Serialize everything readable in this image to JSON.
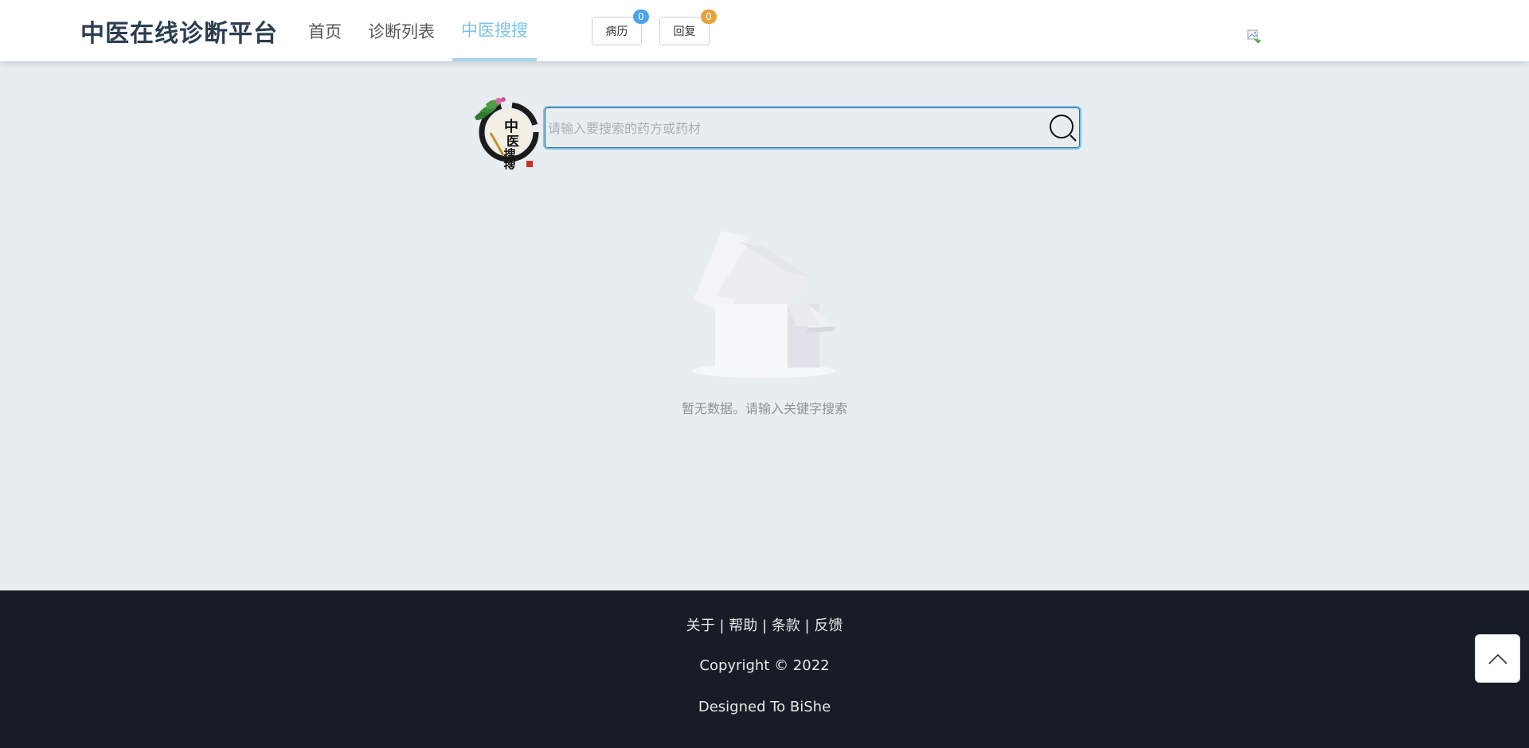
{
  "header": {
    "brand": "中医在线诊断平台",
    "nav": [
      {
        "label": "首页",
        "active": false
      },
      {
        "label": "诊断列表",
        "active": false
      },
      {
        "label": "中医搜搜",
        "active": true
      }
    ],
    "pills": [
      {
        "label": "病历",
        "badge": "0",
        "badge_color": "#4aa3ea"
      },
      {
        "label": "回复",
        "badge": "0",
        "badge_color": "#e6a23c"
      }
    ],
    "avatar_icon": "broken-image-icon"
  },
  "search": {
    "logo_text": "中医搜搜",
    "placeholder": "请输入要搜索的药方或药材",
    "value": "",
    "button_icon": "search-icon"
  },
  "empty": {
    "illustration_icon": "empty-box-icon",
    "text": "暂无数据。请输入关键字搜索"
  },
  "footer": {
    "links": [
      "关于",
      "帮助",
      "条款",
      "反馈"
    ],
    "separator": "|",
    "copyright": "Copyright © 2022",
    "designed": "Designed To BiShe"
  },
  "back_top_icon": "chevron-up-icon",
  "colors": {
    "accent": "#7ec2e6",
    "footer_bg": "#171c26",
    "page_bg": "#e8edf1"
  }
}
